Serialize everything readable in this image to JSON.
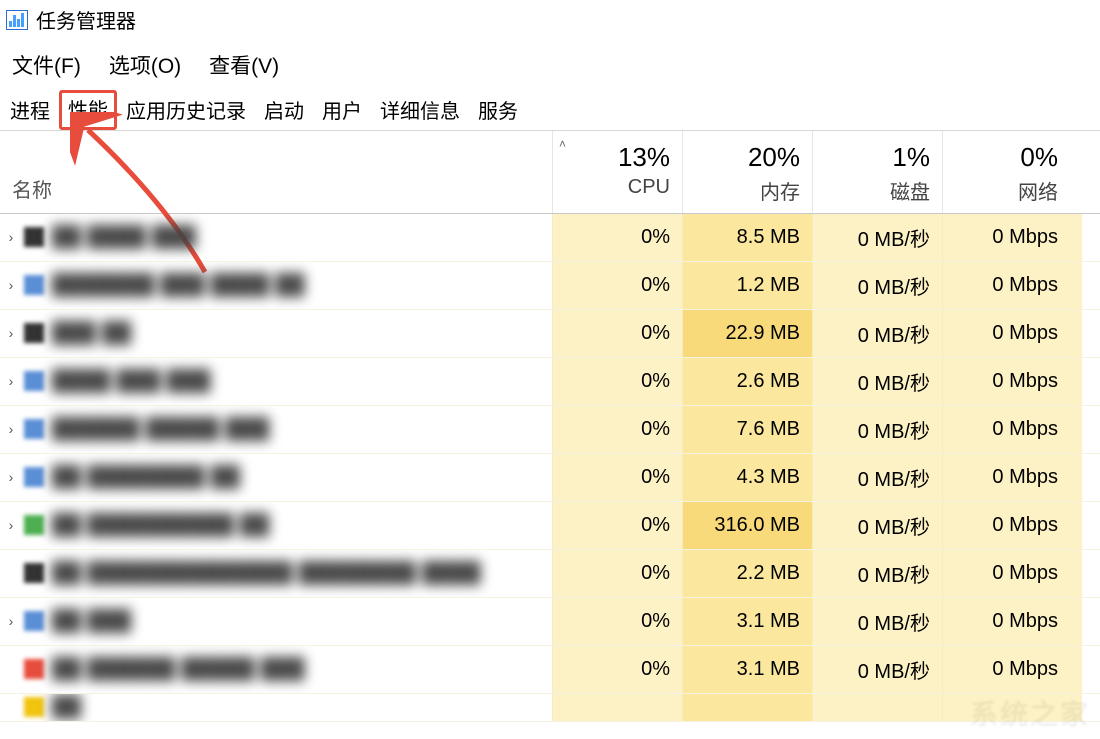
{
  "window": {
    "title": "任务管理器"
  },
  "menu": {
    "file": "文件(F)",
    "options": "选项(O)",
    "view": "查看(V)"
  },
  "tabs": {
    "processes": "进程",
    "performance": "性能",
    "app_history": "应用历史记录",
    "startup": "启动",
    "users": "用户",
    "details": "详细信息",
    "services": "服务"
  },
  "annotation": {
    "highlighted_tab": "performance",
    "arrow_color": "#e74c3c"
  },
  "columns": {
    "name": "名称",
    "cpu": {
      "value": "13%",
      "label": "CPU",
      "sorted": true
    },
    "mem": {
      "value": "20%",
      "label": "内存"
    },
    "disk": {
      "value": "1%",
      "label": "磁盘"
    },
    "net": {
      "value": "0%",
      "label": "网络"
    }
  },
  "rows": [
    {
      "expandable": true,
      "cpu": "0%",
      "mem": "8.5 MB",
      "disk": "0 MB/秒",
      "net": "0 Mbps"
    },
    {
      "expandable": true,
      "cpu": "0%",
      "mem": "1.2 MB",
      "disk": "0 MB/秒",
      "net": "0 Mbps"
    },
    {
      "expandable": true,
      "cpu": "0%",
      "mem": "22.9 MB",
      "disk": "0 MB/秒",
      "net": "0 Mbps"
    },
    {
      "expandable": true,
      "cpu": "0%",
      "mem": "2.6 MB",
      "disk": "0 MB/秒",
      "net": "0 Mbps"
    },
    {
      "expandable": true,
      "cpu": "0%",
      "mem": "7.6 MB",
      "disk": "0 MB/秒",
      "net": "0 Mbps"
    },
    {
      "expandable": true,
      "cpu": "0%",
      "mem": "4.3 MB",
      "disk": "0 MB/秒",
      "net": "0 Mbps"
    },
    {
      "expandable": true,
      "cpu": "0%",
      "mem": "316.0 MB",
      "disk": "0 MB/秒",
      "net": "0 Mbps"
    },
    {
      "expandable": false,
      "cpu": "0%",
      "mem": "2.2 MB",
      "disk": "0 MB/秒",
      "net": "0 Mbps"
    },
    {
      "expandable": true,
      "cpu": "0%",
      "mem": "3.1 MB",
      "disk": "0 MB/秒",
      "net": "0 Mbps"
    },
    {
      "expandable": false,
      "cpu": "0%",
      "mem": "3.1 MB",
      "disk": "0 MB/秒",
      "net": "0 Mbps"
    }
  ]
}
